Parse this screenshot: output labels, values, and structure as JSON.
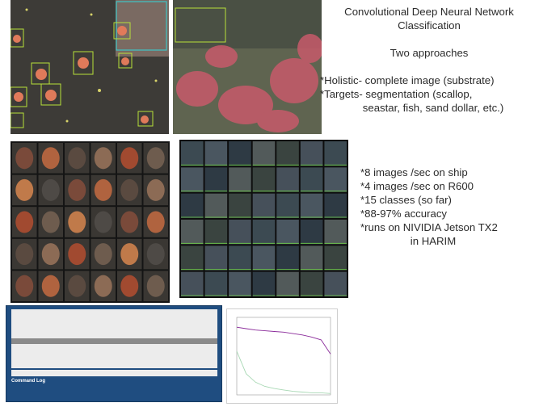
{
  "slide": {
    "title_line1": "Convolutional Deep Neural Network",
    "title_line2": "Classification",
    "approaches_heading": "Two approaches",
    "approach_holistic": "*Holistic- complete image (substrate)",
    "approach_targets_1": "*Targets- segmentation (scallop,",
    "approach_targets_2": "seastar, fish, sand dollar, etc.)"
  },
  "stats": [
    "*8 images /sec on ship",
    "*4 images /sec on R600",
    "*15 classes (so far)",
    "*88-97% accuracy",
    "*runs on NIVIDIA Jetson TX2"
  ],
  "stats_last": "in HARIM",
  "results_window": {
    "columns": [
      "",
      "",
      "",
      "",
      ""
    ],
    "rows": [
      [
        "",
        "",
        "",
        "",
        ""
      ],
      [
        "",
        "",
        "",
        "",
        ""
      ],
      [
        "",
        "",
        "",
        "",
        ""
      ],
      [
        "",
        "",
        "",
        "",
        ""
      ],
      [
        "",
        "",
        "",
        "",
        ""
      ]
    ],
    "total_row": [
      "",
      "",
      "",
      "",
      ""
    ],
    "command_log_label": "Command Log"
  },
  "chart_data": {
    "type": "line",
    "title": "",
    "xlabel": "",
    "ylabel": "",
    "x": [
      0.0,
      0.1,
      0.2,
      0.3,
      0.4,
      0.5,
      0.6,
      0.7,
      0.8,
      0.9,
      1.0
    ],
    "ylim": [
      0,
      110
    ],
    "series": [
      {
        "color": "#8a2a9a",
        "values": [
          96,
          94,
          92,
          91,
          90,
          89,
          87,
          85,
          82,
          78,
          58
        ]
      },
      {
        "color": "#a8d8b4",
        "values": [
          62,
          30,
          18,
          12,
          9,
          7,
          5,
          4,
          3,
          3,
          2
        ]
      }
    ]
  },
  "colors": {
    "seafloor": "#44413c",
    "seastar": "#e07a5a",
    "detection_box": "#b8e03a",
    "window_bg": "#1f4d80"
  }
}
